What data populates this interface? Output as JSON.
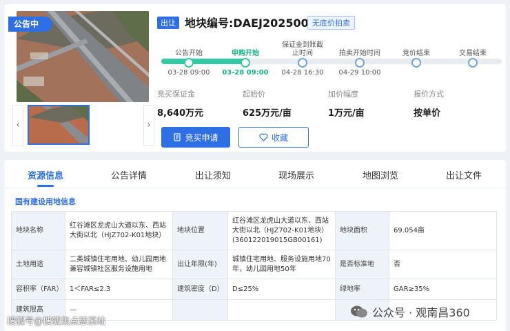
{
  "status_badge": "公告中",
  "sale_tag": "出让",
  "parcel_title": "地块编号:DAEJ2025003",
  "reserve_tag": "无底价拍卖",
  "timeline": [
    {
      "label": "公告开始",
      "time": "03-28 09:00",
      "state": "done"
    },
    {
      "label": "申购开始",
      "time": "03-28 09:00",
      "state": "active"
    },
    {
      "label": "保证金到账截止时间",
      "time": "04-28 16:30",
      "state": "pending"
    },
    {
      "label": "拍卖开始时间",
      "time": "04-29 10:00",
      "state": "pending"
    },
    {
      "label": "竞价结束",
      "time": "",
      "state": "pending"
    },
    {
      "label": "交易结束",
      "time": "",
      "state": "pending"
    }
  ],
  "metrics": [
    {
      "label": "竞买保证金",
      "value": "8,640万元"
    },
    {
      "label": "起始价",
      "value": "625万元/亩"
    },
    {
      "label": "加价幅度",
      "value": "1万元/亩"
    },
    {
      "label": "报价方式",
      "value": "按单价"
    }
  ],
  "buttons": {
    "apply": "竞买申请",
    "favorite": "收藏"
  },
  "tabs": [
    "资源信息",
    "公告详情",
    "出让须知",
    "现场展示",
    "地图浏览",
    "出让文件"
  ],
  "section_title": "国有建设用地信息",
  "table": [
    [
      "地块名称",
      "红谷滩区龙虎山大道以东、西站大街以北（HJZ702-K01地块）",
      "地块位置",
      "红谷滩区龙虎山大道以东、西站大街以北（HJZ702-K01地块）(360122019015GB00161)",
      "地块面积",
      "69.054亩"
    ],
    [
      "土地用途",
      "二类城镇住宅用地、幼儿园用地兼容城镇社区服务设施用地",
      "出让年限(年)",
      "城镇住宅用地、服务设施用地70年，幼儿园用地50年",
      "是否标准地",
      "否"
    ],
    [
      "容积率（FAR）",
      "1＜FAR≤2.3",
      "建筑密度（D）",
      "D≤25%",
      "绿地率",
      "GAR≥35%"
    ],
    [
      "建筑限高",
      "—",
      "",
      "",
      "",
      ""
    ]
  ],
  "watermark_left": "搜狐号@搜狐焦点慈溪站",
  "watermark_right": "公众号 · 观南昌360",
  "colors": {
    "primary": "#2f6fe4",
    "progress": "#34c9a5",
    "active_text": "#17b38a"
  }
}
